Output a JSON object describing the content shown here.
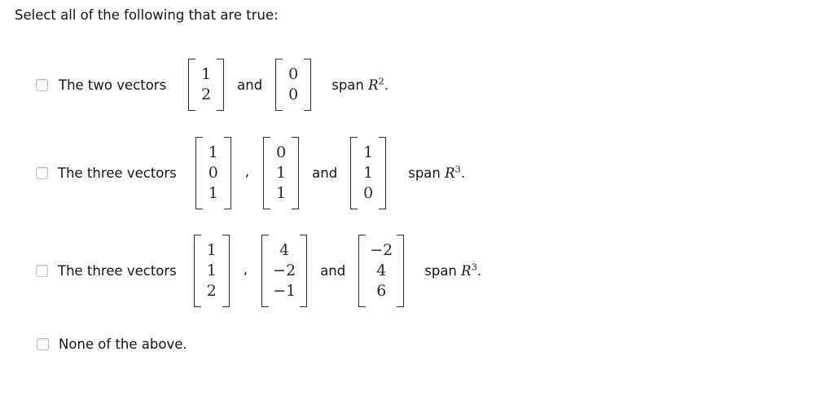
{
  "prompt": "Select all of the following that are true:",
  "colors": {
    "background": "#ffffff",
    "text": "#141414",
    "math": "#2b2b2b",
    "checkbox_border": "#bdbdbd",
    "checkbox_fill": "#fbfbfb"
  },
  "options": [
    {
      "id": "option-1",
      "checked": false,
      "label": "The two vectors",
      "matrices": [
        {
          "values": [
            "1",
            "2"
          ]
        },
        {
          "values": [
            "0",
            "0"
          ]
        }
      ],
      "separators": [
        "and"
      ],
      "conclusion": {
        "prefix": "span ",
        "symbol": "R",
        "exponent": "2",
        "suffix": "."
      }
    },
    {
      "id": "option-2",
      "checked": false,
      "label": "The three vectors",
      "matrices": [
        {
          "values": [
            "1",
            "0",
            "1"
          ]
        },
        {
          "values": [
            "0",
            "1",
            "1"
          ]
        },
        {
          "values": [
            "1",
            "1",
            "0"
          ]
        }
      ],
      "separators": [
        ",",
        "and"
      ],
      "conclusion": {
        "prefix": "span ",
        "symbol": "R",
        "exponent": "3",
        "suffix": "."
      }
    },
    {
      "id": "option-3",
      "checked": false,
      "label": "The three vectors",
      "matrices": [
        {
          "values": [
            "1",
            "1",
            "2"
          ]
        },
        {
          "values": [
            "4",
            "−2",
            "−1"
          ]
        },
        {
          "values": [
            "−2",
            "4",
            "6"
          ]
        }
      ],
      "separators": [
        ",",
        "and"
      ],
      "conclusion": {
        "prefix": "span ",
        "symbol": "R",
        "exponent": "3",
        "suffix": "."
      }
    },
    {
      "id": "option-4",
      "checked": false,
      "label": "None of the above.",
      "matrices": [],
      "separators": [],
      "conclusion": null
    }
  ]
}
